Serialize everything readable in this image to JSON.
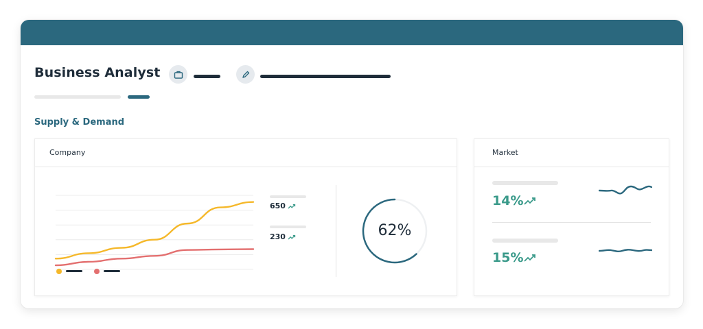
{
  "header": {
    "title": "Business Analyst"
  },
  "section": {
    "label": "Supply & Demand"
  },
  "company": {
    "label": "Company",
    "stats": [
      {
        "value": "650"
      },
      {
        "value": "230"
      }
    ],
    "gauge": {
      "label": "62%",
      "fraction": 0.62
    }
  },
  "market": {
    "label": "Market",
    "items": [
      {
        "value": "14%"
      },
      {
        "value": "15%"
      }
    ]
  },
  "colors": {
    "accent": "#2b687e",
    "series_yellow": "#f5b82a",
    "series_red": "#e36f6f",
    "positive": "#3a9a8a"
  },
  "icons": {
    "job": "briefcase-icon",
    "edit": "pencil-icon",
    "trend": "trend-up-icon"
  },
  "chart_data": {
    "type": "line",
    "x": [
      1,
      2,
      3,
      4,
      5,
      6,
      7
    ],
    "series": [
      {
        "values": [
          0.4,
          0.6,
          0.8,
          1.1,
          1.7,
          2.3,
          2.5
        ]
      },
      {
        "values": [
          0.15,
          0.28,
          0.4,
          0.5,
          0.72,
          0.74,
          0.75
        ]
      }
    ],
    "ylim": [
      0,
      3
    ],
    "grid": true,
    "legend": "bottom-left"
  }
}
